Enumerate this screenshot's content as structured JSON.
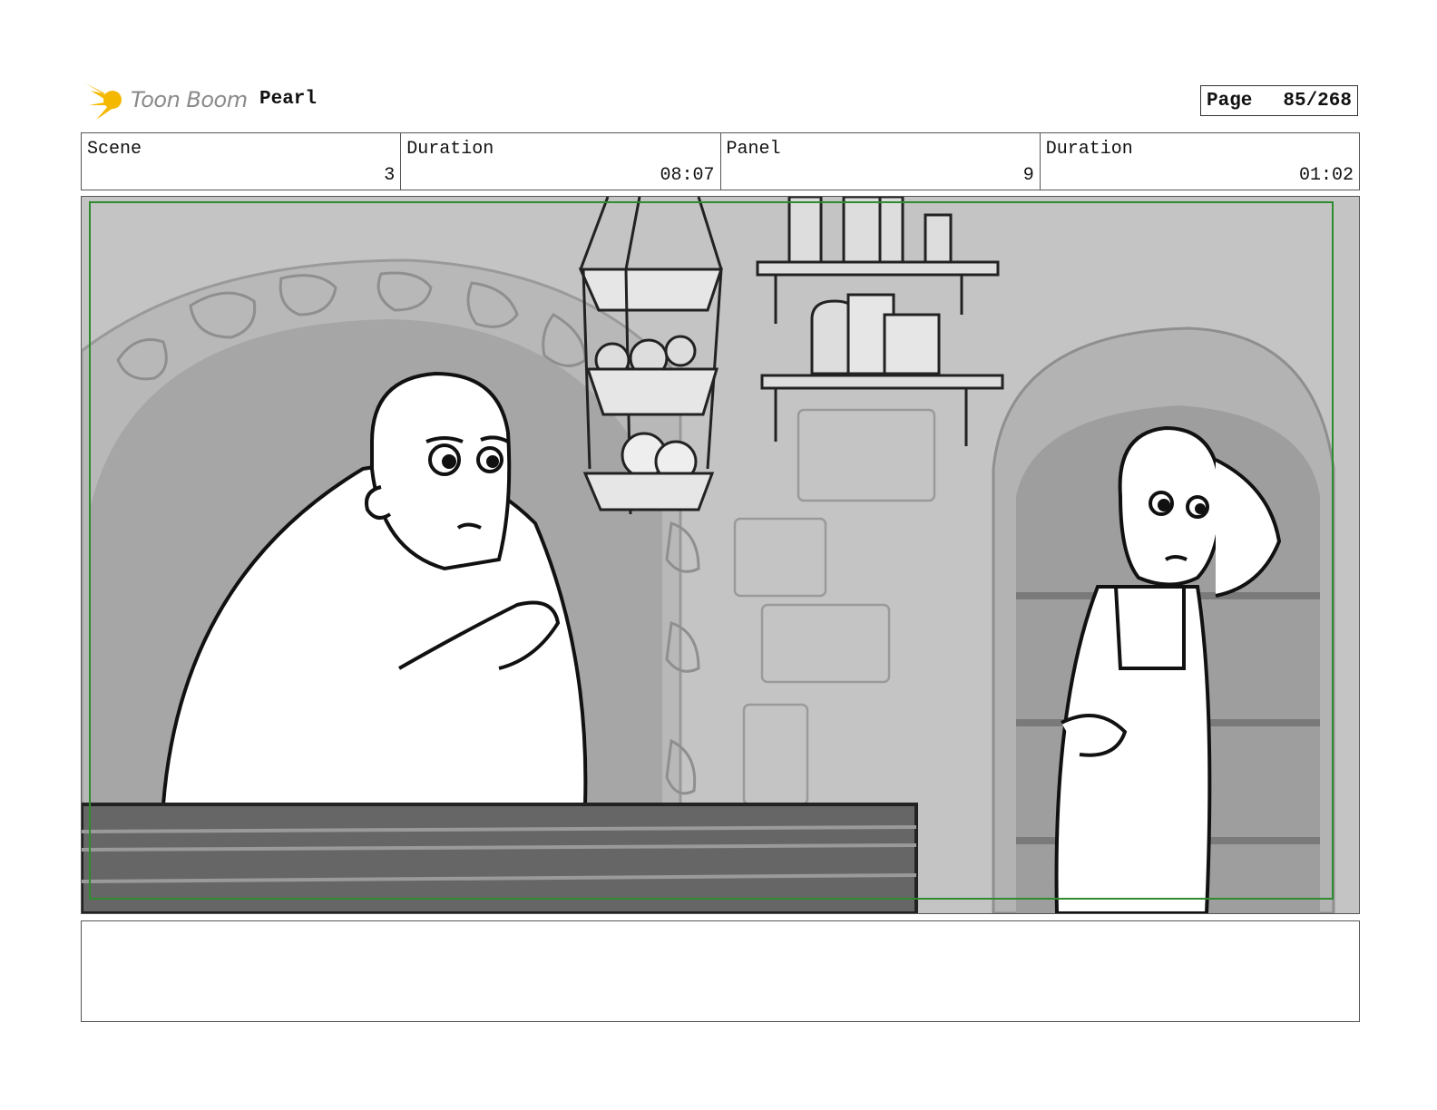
{
  "header": {
    "logo_text": "Toon Boom",
    "project": "Pearl",
    "page_label": "Page",
    "page_value": "85/268"
  },
  "info": {
    "scene_label": "Scene",
    "scene_value": "3",
    "scene_duration_label": "Duration",
    "scene_duration_value": "08:07",
    "panel_label": "Panel",
    "panel_value": "9",
    "panel_duration_label": "Duration",
    "panel_duration_value": "01:02"
  },
  "notes": {
    "text": ""
  },
  "colors": {
    "logo_star": "#f5b800",
    "safe_frame": "#2e8b2e",
    "wall": "#c4c4c4",
    "arch_shadow": "#a6a6a6",
    "counter": "#666666"
  }
}
